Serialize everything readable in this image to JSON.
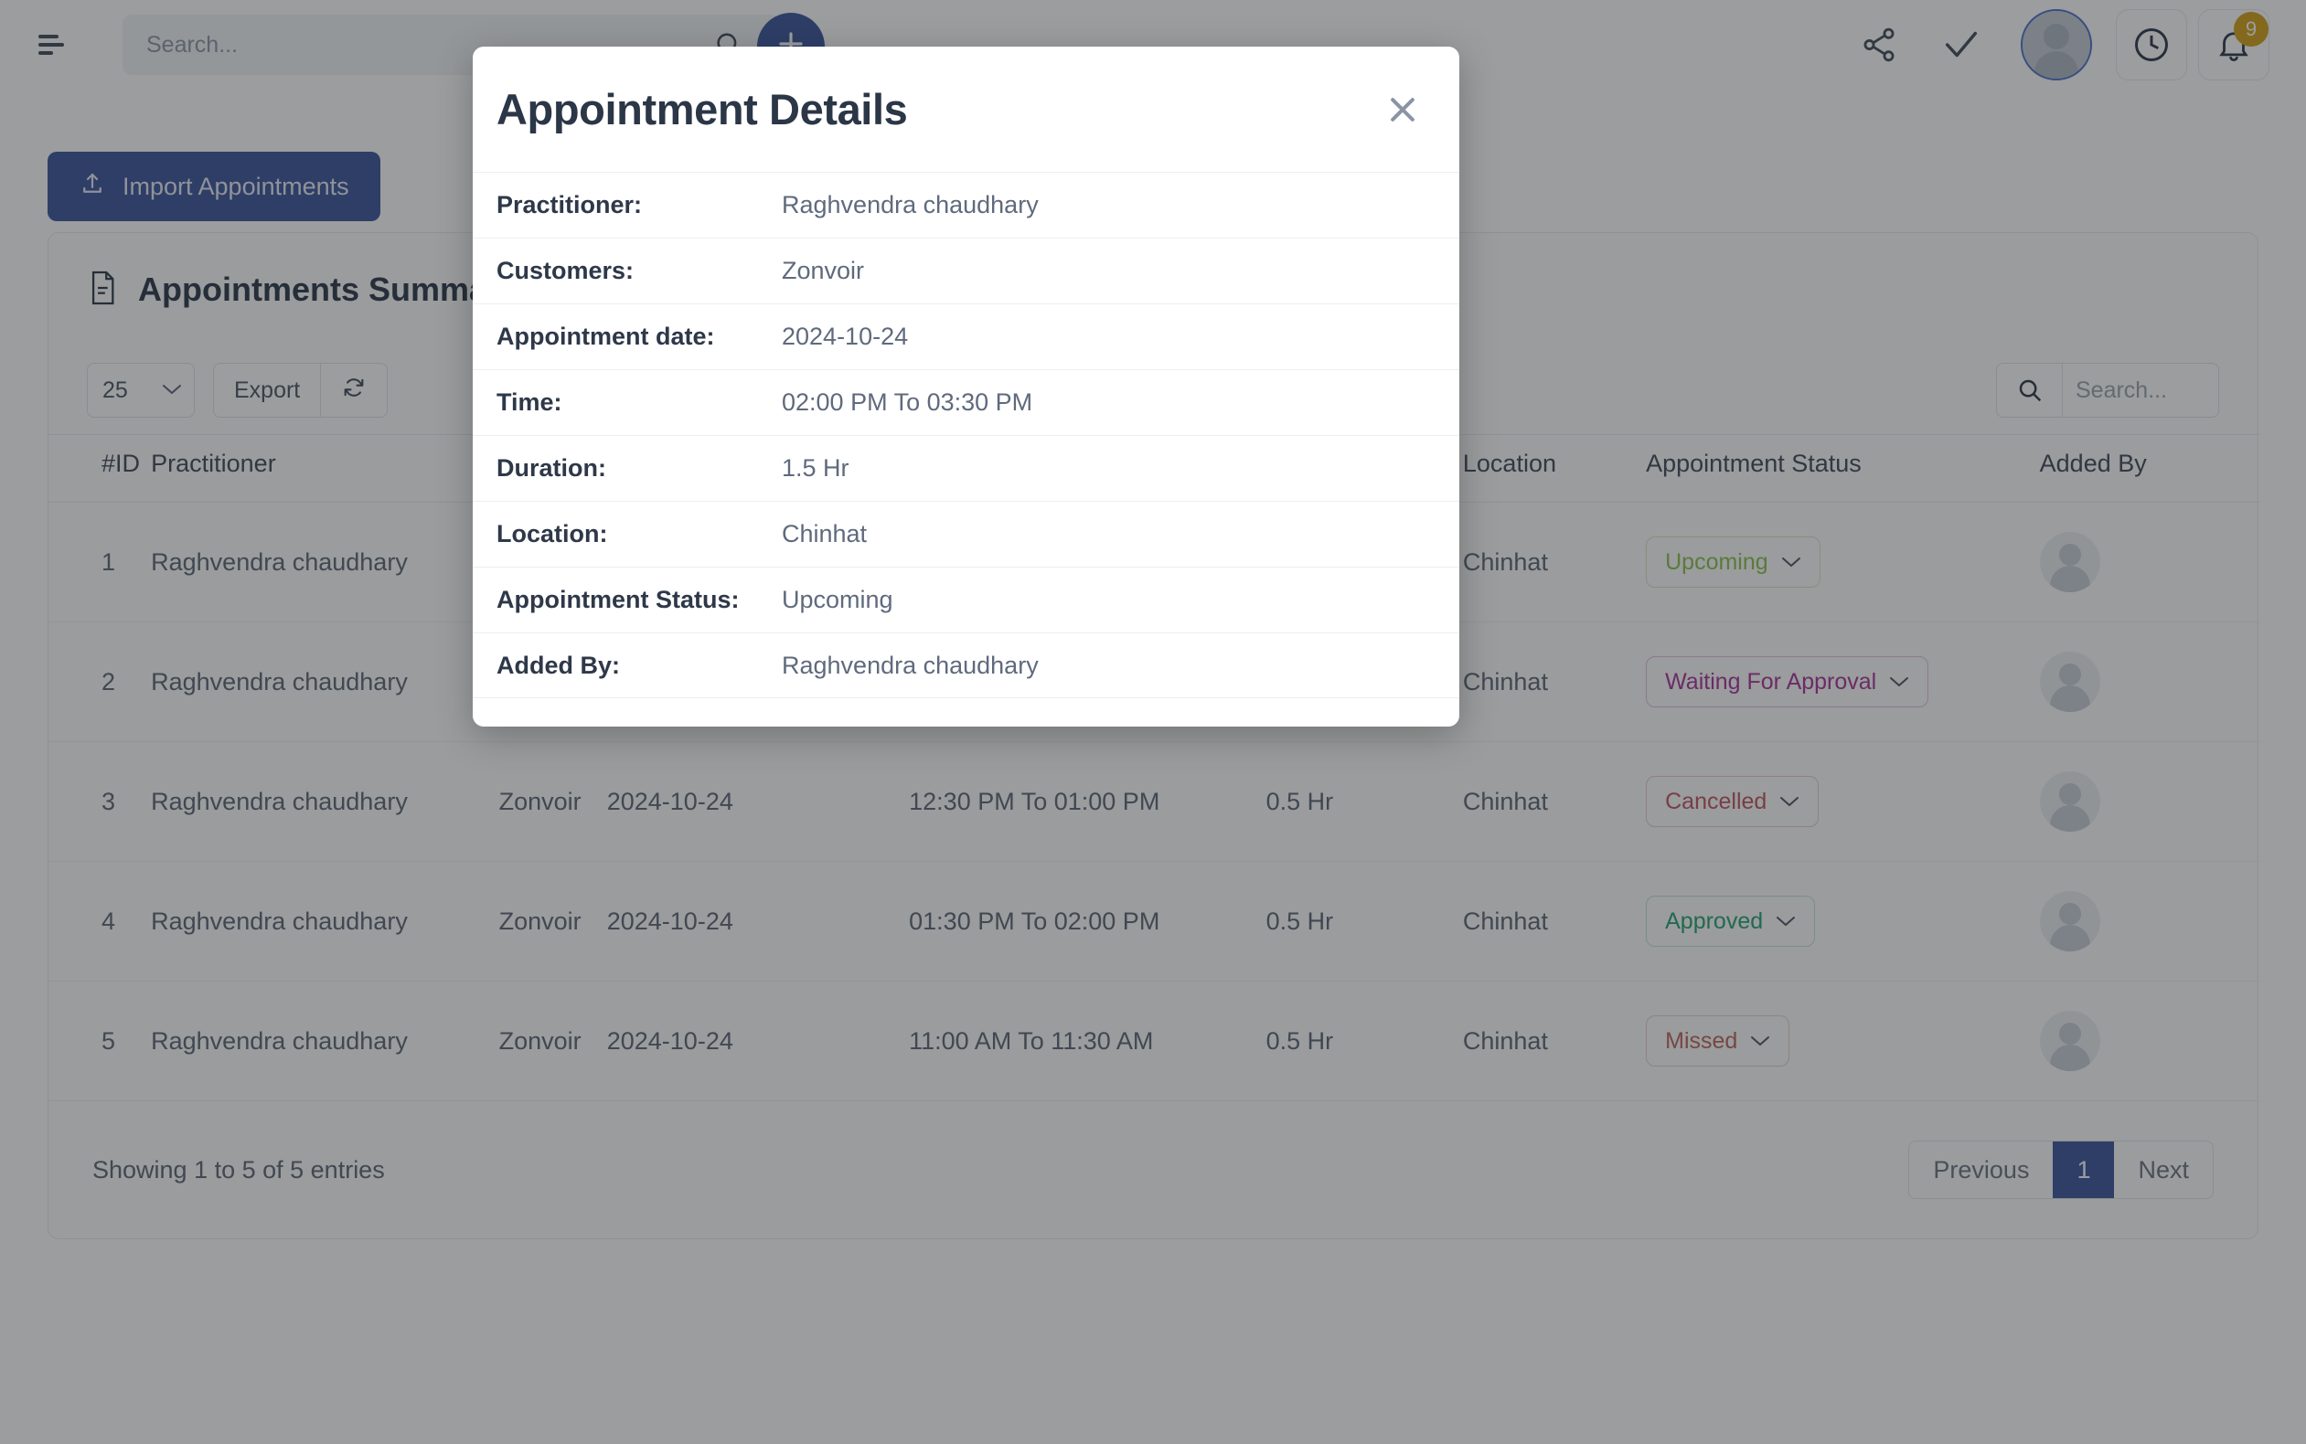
{
  "topbar": {
    "menu_icon": "hamburger-icon",
    "search_placeholder": "Search...",
    "search_value": "",
    "search_icon": "search-icon",
    "add_label": "+",
    "share_icon": "share-icon",
    "check_icon": "check-icon",
    "avatar_icon": "user-avatar-icon",
    "history_icon": "clock-icon",
    "bell_icon": "bell-icon",
    "notification_count": "9"
  },
  "actions": {
    "import_label": "Import Appointments",
    "import_icon": "upload-icon"
  },
  "card": {
    "title": "Appointments Summary",
    "title_icon": "document-icon",
    "page_size": "25",
    "page_size_options": [
      "25"
    ],
    "export_label": "Export",
    "refresh_icon": "refresh-icon",
    "chevron_icon": "chevron-down-icon",
    "table_search_placeholder": "Search...",
    "table_search_value": "",
    "table_search_icon": "search-icon"
  },
  "table": {
    "columns": [
      "#ID",
      "Practitioner",
      "Customers",
      "Appointment date",
      "Time",
      "Duration",
      "Location",
      "Appointment Status",
      "Added By"
    ],
    "rows": [
      {
        "id": "1",
        "practitioner": "Raghvendra chaudhary",
        "customer": "Zonvoir",
        "date": "2024-10-24",
        "time": "02:00 PM To 03:30 PM",
        "duration": "1.5 Hr",
        "location": "Chinhat",
        "status": "Upcoming",
        "status_class": "upcoming",
        "added_by": "user-avatar-icon"
      },
      {
        "id": "2",
        "practitioner": "Raghvendra chaudhary",
        "customer": "Zonvoir",
        "date": "2024-10-24",
        "time": "",
        "duration": "",
        "location": "Chinhat",
        "status": "Waiting For Approval",
        "status_class": "waiting",
        "added_by": "user-avatar-icon"
      },
      {
        "id": "3",
        "practitioner": "Raghvendra chaudhary",
        "customer": "Zonvoir",
        "date": "2024-10-24",
        "time": "12:30 PM To 01:00 PM",
        "duration": "0.5 Hr",
        "location": "Chinhat",
        "status": "Cancelled",
        "status_class": "cancelled",
        "added_by": "user-avatar-icon"
      },
      {
        "id": "4",
        "practitioner": "Raghvendra chaudhary",
        "customer": "Zonvoir",
        "date": "2024-10-24",
        "time": "01:30 PM To 02:00 PM",
        "duration": "0.5 Hr",
        "location": "Chinhat",
        "status": "Approved",
        "status_class": "approved",
        "added_by": "user-avatar-icon"
      },
      {
        "id": "5",
        "practitioner": "Raghvendra chaudhary",
        "customer": "Zonvoir",
        "date": "2024-10-24",
        "time": "11:00 AM To 11:30 AM",
        "duration": "0.5 Hr",
        "location": "Chinhat",
        "status": "Missed",
        "status_class": "missed",
        "added_by": "user-avatar-icon"
      }
    ]
  },
  "footer": {
    "entries": "Showing 1 to 5 of 5 entries",
    "previous_label": "Previous",
    "page_label": "1",
    "next_label": "Next"
  },
  "modal": {
    "title": "Appointment Details",
    "close_icon": "close-icon",
    "rows": [
      {
        "label": "Practitioner:",
        "value": "Raghvendra chaudhary"
      },
      {
        "label": "Customers:",
        "value": "Zonvoir"
      },
      {
        "label": "Appointment date:",
        "value": "2024-10-24"
      },
      {
        "label": "Time:",
        "value": "02:00 PM To 03:30 PM"
      },
      {
        "label": "Duration:",
        "value": "1.5 Hr"
      },
      {
        "label": "Location:",
        "value": "Chinhat"
      },
      {
        "label": "Appointment Status:",
        "value": "Upcoming"
      },
      {
        "label": "Added By:",
        "value": "Raghvendra chaudhary"
      }
    ]
  },
  "colors": {
    "brand": "#3a539b",
    "upcoming": "#8bbf4e",
    "waiting": "#a9309a",
    "cancelled": "#c0525f",
    "approved": "#24a06f",
    "missed": "#c0625a",
    "badge": "#d4a017"
  }
}
